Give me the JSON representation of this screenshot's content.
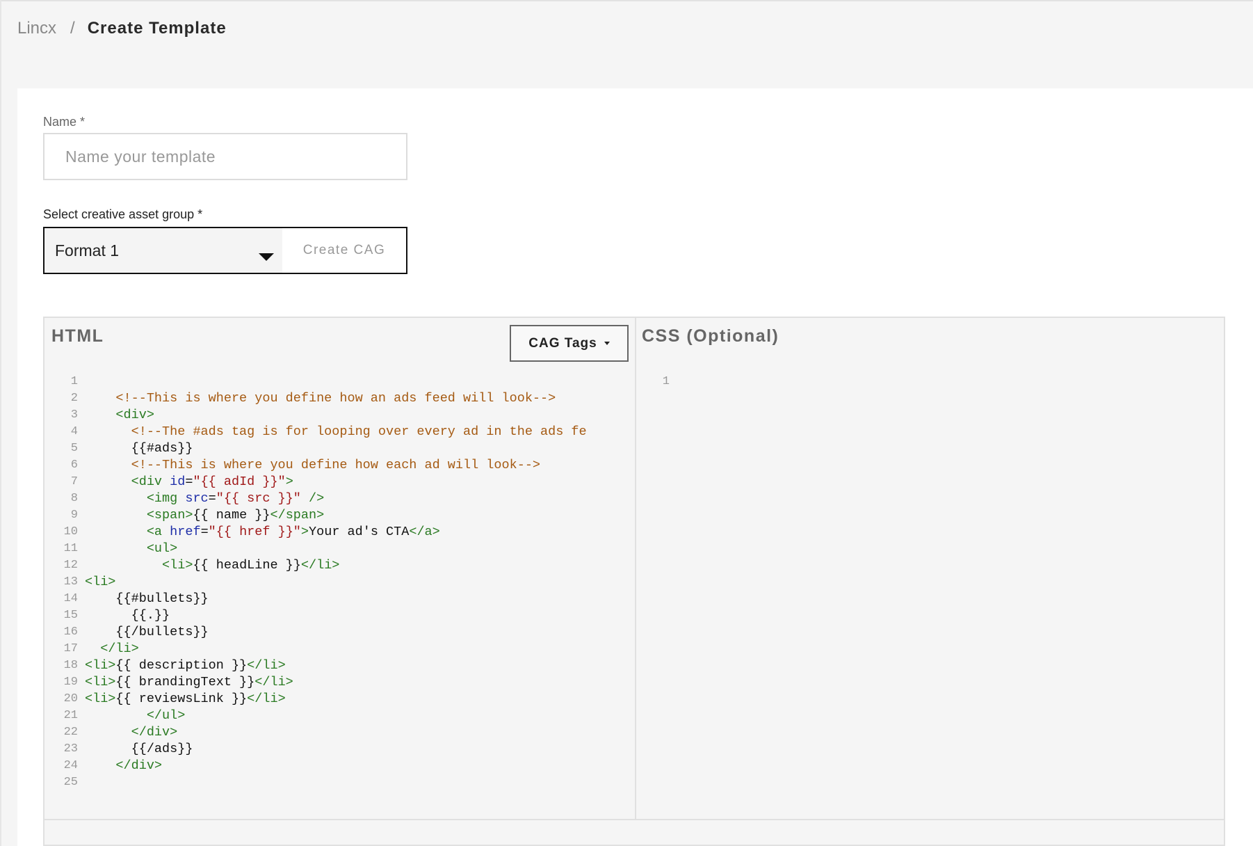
{
  "breadcrumb": {
    "root": "Lincx",
    "separator": "/",
    "current": "Create Template"
  },
  "form": {
    "name_label": "Name *",
    "name_placeholder": "Name your template",
    "name_value": "",
    "cag_label": "Select creative asset group *",
    "cag_selected": "Format 1",
    "create_cag_label": "Create CAG"
  },
  "editor": {
    "html_title": "HTML",
    "css_title": "CSS (Optional)",
    "cag_tags_label": "CAG Tags",
    "css_line_number": "1",
    "html_lines": [
      {
        "n": "1",
        "tokens": []
      },
      {
        "n": "2",
        "tokens": [
          {
            "t": "    "
          },
          {
            "c": "c-comment",
            "t": "<!--This is where you define how an ads feed will look-->"
          }
        ]
      },
      {
        "n": "3",
        "tokens": [
          {
            "t": "    "
          },
          {
            "c": "c-tag",
            "t": "<div>"
          }
        ]
      },
      {
        "n": "4",
        "tokens": [
          {
            "t": "      "
          },
          {
            "c": "c-comment",
            "t": "<!--The #ads tag is for looping over every ad in the ads fe"
          }
        ]
      },
      {
        "n": "5",
        "tokens": [
          {
            "t": "      "
          },
          {
            "c": "c-text",
            "t": "{{#ads}}"
          }
        ]
      },
      {
        "n": "6",
        "tokens": [
          {
            "t": "      "
          },
          {
            "c": "c-comment",
            "t": "<!--This is where you define how each ad will look-->"
          }
        ]
      },
      {
        "n": "7",
        "tokens": [
          {
            "t": "      "
          },
          {
            "c": "c-tag",
            "t": "<div "
          },
          {
            "c": "c-attr",
            "t": "id"
          },
          {
            "c": "c-text",
            "t": "="
          },
          {
            "c": "c-str",
            "t": "\"{{ adId }}\""
          },
          {
            "c": "c-tag",
            "t": ">"
          }
        ]
      },
      {
        "n": "8",
        "tokens": [
          {
            "t": "        "
          },
          {
            "c": "c-tag",
            "t": "<img "
          },
          {
            "c": "c-attr",
            "t": "src"
          },
          {
            "c": "c-text",
            "t": "="
          },
          {
            "c": "c-str",
            "t": "\"{{ src }}\""
          },
          {
            "c": "c-tag",
            "t": " />"
          }
        ]
      },
      {
        "n": "9",
        "tokens": [
          {
            "t": "        "
          },
          {
            "c": "c-tag",
            "t": "<span>"
          },
          {
            "c": "c-text",
            "t": "{{ name }}"
          },
          {
            "c": "c-tag",
            "t": "</span>"
          }
        ]
      },
      {
        "n": "10",
        "tokens": [
          {
            "t": "        "
          },
          {
            "c": "c-tag",
            "t": "<a "
          },
          {
            "c": "c-attr",
            "t": "href"
          },
          {
            "c": "c-text",
            "t": "="
          },
          {
            "c": "c-str",
            "t": "\"{{ href }}\""
          },
          {
            "c": "c-tag",
            "t": ">"
          },
          {
            "c": "c-text",
            "t": "Your ad's CTA"
          },
          {
            "c": "c-tag",
            "t": "</a>"
          }
        ]
      },
      {
        "n": "11",
        "tokens": [
          {
            "t": "        "
          },
          {
            "c": "c-tag",
            "t": "<ul>"
          }
        ]
      },
      {
        "n": "12",
        "tokens": [
          {
            "t": "          "
          },
          {
            "c": "c-tag",
            "t": "<li>"
          },
          {
            "c": "c-text",
            "t": "{{ headLine }}"
          },
          {
            "c": "c-tag",
            "t": "</li>"
          }
        ]
      },
      {
        "n": "13",
        "tokens": [
          {
            "c": "c-tag",
            "t": "<li>"
          }
        ]
      },
      {
        "n": "14",
        "tokens": [
          {
            "t": "    "
          },
          {
            "c": "c-text",
            "t": "{{#bullets}}"
          }
        ]
      },
      {
        "n": "15",
        "tokens": [
          {
            "t": "      "
          },
          {
            "c": "c-text",
            "t": "{{.}}"
          }
        ]
      },
      {
        "n": "16",
        "tokens": [
          {
            "t": "    "
          },
          {
            "c": "c-text",
            "t": "{{/bullets}}"
          }
        ]
      },
      {
        "n": "17",
        "tokens": [
          {
            "t": "  "
          },
          {
            "c": "c-tag",
            "t": "</li>"
          }
        ]
      },
      {
        "n": "18",
        "tokens": [
          {
            "c": "c-tag",
            "t": "<li>"
          },
          {
            "c": "c-text",
            "t": "{{ description }}"
          },
          {
            "c": "c-tag",
            "t": "</li>"
          }
        ]
      },
      {
        "n": "19",
        "tokens": [
          {
            "c": "c-tag",
            "t": "<li>"
          },
          {
            "c": "c-text",
            "t": "{{ brandingText }}"
          },
          {
            "c": "c-tag",
            "t": "</li>"
          }
        ]
      },
      {
        "n": "20",
        "tokens": [
          {
            "c": "c-tag",
            "t": "<li>"
          },
          {
            "c": "c-text",
            "t": "{{ reviewsLink }}"
          },
          {
            "c": "c-tag",
            "t": "</li>"
          }
        ]
      },
      {
        "n": "21",
        "tokens": [
          {
            "t": "        "
          },
          {
            "c": "c-tag",
            "t": "</ul>"
          }
        ]
      },
      {
        "n": "22",
        "tokens": [
          {
            "t": "      "
          },
          {
            "c": "c-tag",
            "t": "</div>"
          }
        ]
      },
      {
        "n": "23",
        "tokens": [
          {
            "t": "      "
          },
          {
            "c": "c-text",
            "t": "{{/ads}}"
          }
        ]
      },
      {
        "n": "24",
        "tokens": [
          {
            "t": "    "
          },
          {
            "c": "c-tag",
            "t": "</div>"
          }
        ]
      },
      {
        "n": "25",
        "tokens": []
      }
    ]
  },
  "icons": {
    "dropdown": "chevron-down-icon",
    "cag_tags_caret": "caret-down-icon"
  }
}
